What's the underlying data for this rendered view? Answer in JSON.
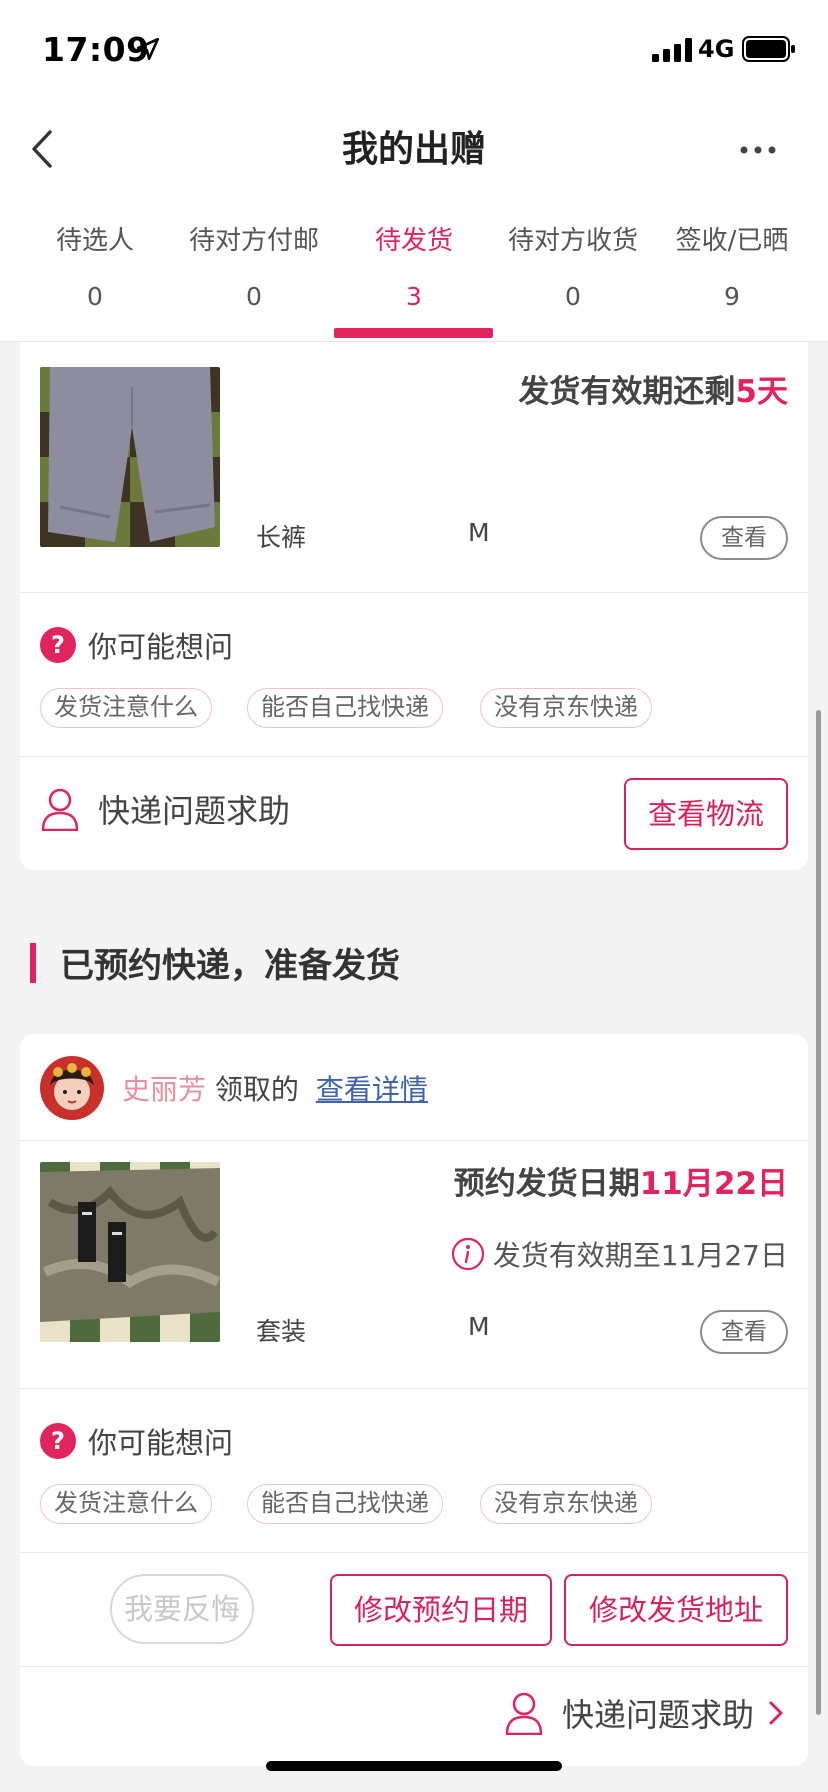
{
  "status_bar": {
    "time": "17:09",
    "network": "4G"
  },
  "nav": {
    "title": "我的出赠"
  },
  "tabs": [
    {
      "label": "待选人",
      "count": "0"
    },
    {
      "label": "待对方付邮",
      "count": "0"
    },
    {
      "label": "待发货",
      "count": "3",
      "active": true
    },
    {
      "label": "待对方收货",
      "count": "0"
    },
    {
      "label": "签收/已晒",
      "count": "9"
    }
  ],
  "card1": {
    "deadline_prefix": "发货有效期还剩",
    "deadline_value": "5天",
    "item_name": "长裤",
    "item_size": "M",
    "view_label": "查看",
    "faq_title": "你可能想问",
    "faq_chips": [
      "发货注意什么",
      "能否自己找快递",
      "没有京东快递"
    ],
    "help_label": "快递问题求助",
    "logistics_label": "查看物流"
  },
  "section": {
    "title": "已预约快递，准备发货"
  },
  "card2": {
    "receiver_name": "史丽芳",
    "receiver_suffix": "领取的",
    "details_link": "查看详情",
    "booking_prefix": "预约发货日期",
    "booking_date": "11月22日",
    "valid_until": "发货有效期至11月27日",
    "item_name": "套装",
    "item_size": "M",
    "view_label": "查看",
    "faq_title": "你可能想问",
    "faq_chips": [
      "发货注意什么",
      "能否自己找快递",
      "没有京东快递"
    ],
    "regret_label": "我要反悔",
    "change_date_label": "修改预约日期",
    "change_address_label": "修改发货地址",
    "help_label": "快递问题求助"
  },
  "colors": {
    "accent": "#e0245e",
    "link": "#3e63a8",
    "receiver": "#e6909e"
  }
}
